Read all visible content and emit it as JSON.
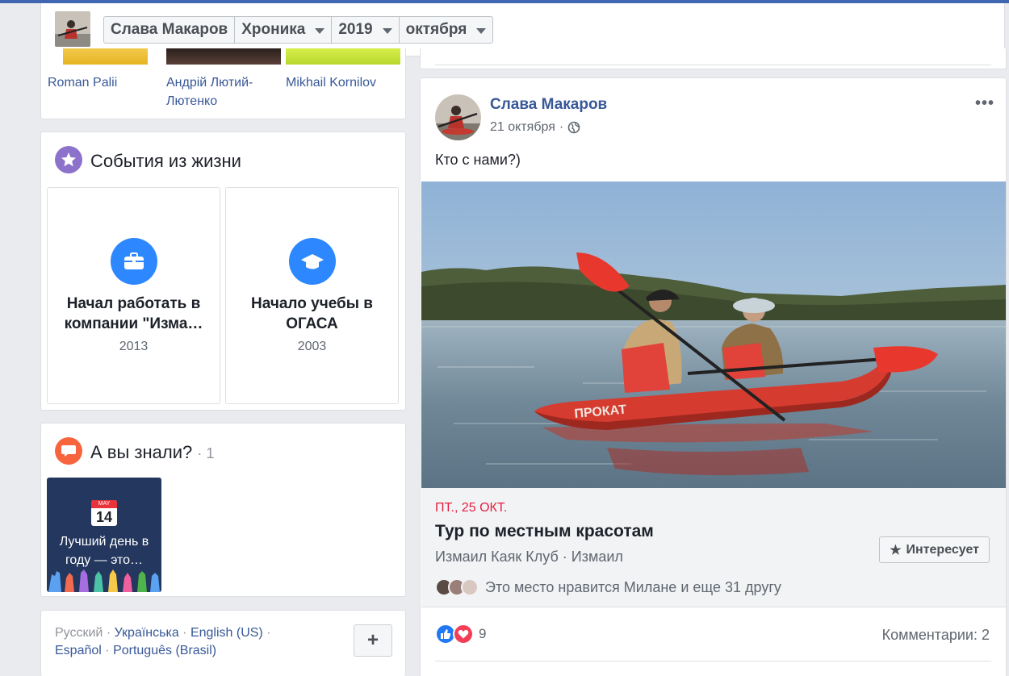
{
  "nav": {
    "name": "Слава Макаров",
    "section": "Хроника",
    "year": "2019",
    "month": "октября"
  },
  "friends": [
    {
      "name": "Roman Palii"
    },
    {
      "name": "Андрій Лютий-Лютенко"
    },
    {
      "name": "Mikhail Kornilov"
    }
  ],
  "life_events": {
    "title": "События из жизни",
    "items": [
      {
        "title": "Начал работать в компании \"Изма…",
        "year": "2013",
        "icon": "briefcase-icon"
      },
      {
        "title": "Начало учебы в ОГАСА",
        "year": "2003",
        "icon": "graduation-cap-icon"
      }
    ]
  },
  "did_you_know": {
    "title": "А вы знали?",
    "count": "· 1",
    "tile": {
      "calendar_month": "MAY",
      "calendar_day": "14",
      "text": "Лучший день в году — это…"
    }
  },
  "languages": {
    "current": "Русский",
    "sep": "·",
    "links": [
      "Українська",
      "English (US)",
      "Español",
      "Português (Brasil)"
    ],
    "add_label": "+"
  },
  "post": {
    "author": "Слава Макаров",
    "date": "21 октября",
    "date_sep": "·",
    "menu": "•••",
    "text": "Кто с нами?)",
    "photo_boat_label": "ПРОКАТ",
    "event": {
      "date": "ПТ., 25 ОКТ.",
      "name": "Тур по местным красотам",
      "place": "Измаил Каяк Клуб · Измаил",
      "interest_label": "Интересует",
      "likes_text": "Это место нравится Милане и еще 31 другу"
    },
    "reactions_count": "9",
    "comments": "Комментарии: 2"
  },
  "colors": {
    "brand": "#4267b2",
    "link": "#385898",
    "event_date": "#e41e3f"
  }
}
